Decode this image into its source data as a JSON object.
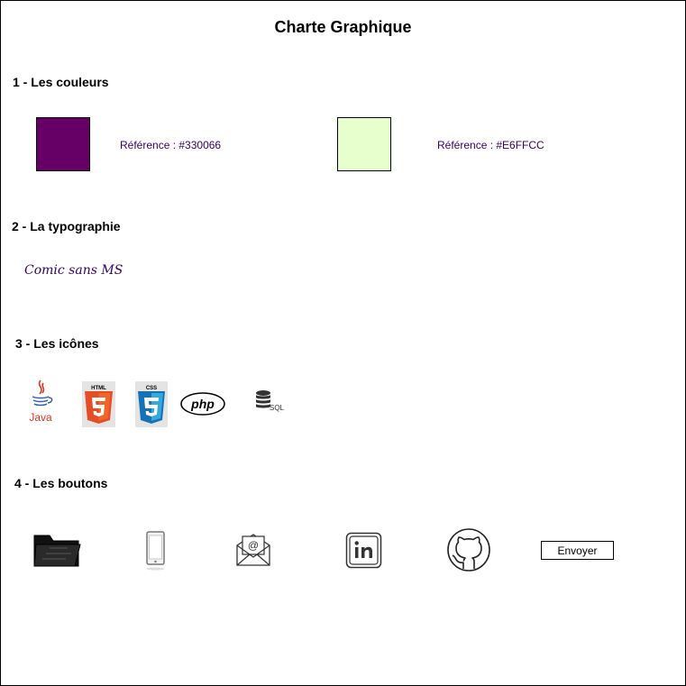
{
  "title": "Charte Graphique",
  "sections": {
    "colors": {
      "heading": "1 - Les couleurs",
      "swatches": [
        {
          "color": "#660066",
          "reference": "Référence : #330066"
        },
        {
          "color": "#E6FFCC",
          "reference": "Référence : #E6FFCC"
        }
      ]
    },
    "typography": {
      "heading": "2 - La typographie",
      "font_sample": "Comic sans MS"
    },
    "icons": {
      "heading": "3 - Les icônes",
      "items": [
        {
          "name": "java-icon",
          "label": "Java"
        },
        {
          "name": "html5-icon",
          "label": "HTML"
        },
        {
          "name": "css3-icon",
          "label": "CSS"
        },
        {
          "name": "php-icon",
          "label": "php"
        },
        {
          "name": "sql-database-icon",
          "label": "SQL"
        }
      ]
    },
    "buttons": {
      "heading": "4 - Les boutons",
      "items": [
        {
          "name": "folder-icon"
        },
        {
          "name": "smartphone-icon"
        },
        {
          "name": "email-icon"
        },
        {
          "name": "linkedin-icon"
        },
        {
          "name": "github-icon"
        }
      ],
      "send_label": "Envoyer"
    }
  },
  "colors": {
    "primary": "#330066",
    "secondary": "#E6FFCC",
    "text": "#000000"
  }
}
